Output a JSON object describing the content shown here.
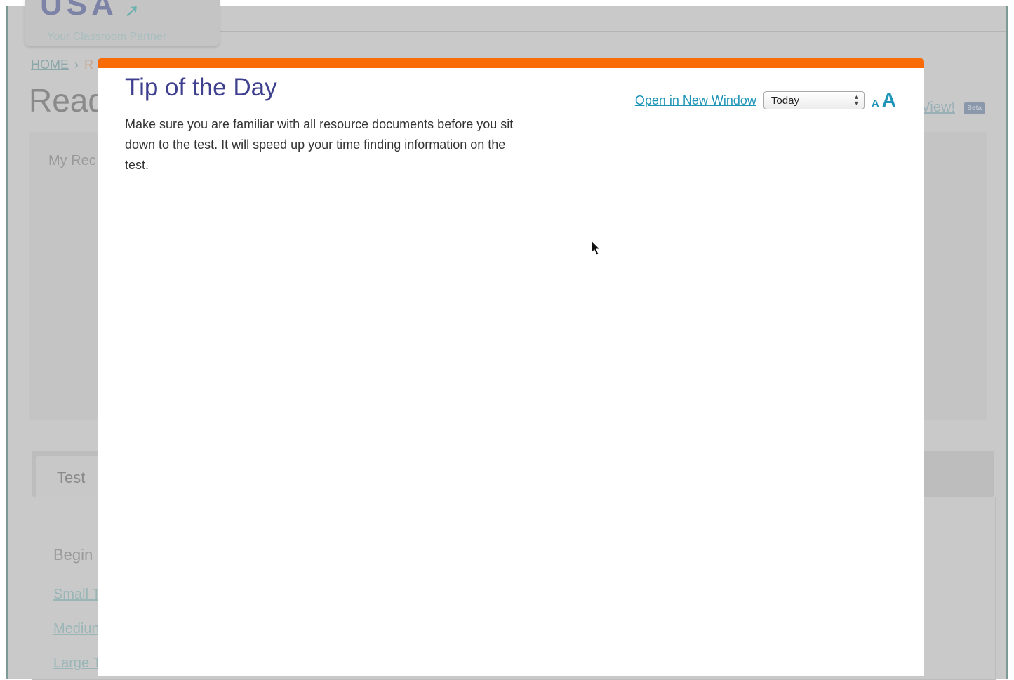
{
  "background": {
    "logo_tagline": "Your Classroom Partner",
    "breadcrumb": {
      "home": "HOME",
      "separator": "›",
      "next": "R"
    },
    "page_title": "Read",
    "panel_label": "My Rec",
    "view_link": "View!",
    "beta_badge": "Beta",
    "tab_label": "Test",
    "begin_label": "Begin",
    "links": [
      "Small T",
      "Mediun",
      "Large T"
    ]
  },
  "modal": {
    "accent_color": "#f86b07",
    "title": "Tip of the Day",
    "body": "Make sure you are familiar with all resource documents before you sit down to the test. It will speed up your time finding information on the test.",
    "open_new_window": "Open in New Window",
    "select_value": "Today",
    "font_small": "A",
    "font_large": "A"
  }
}
